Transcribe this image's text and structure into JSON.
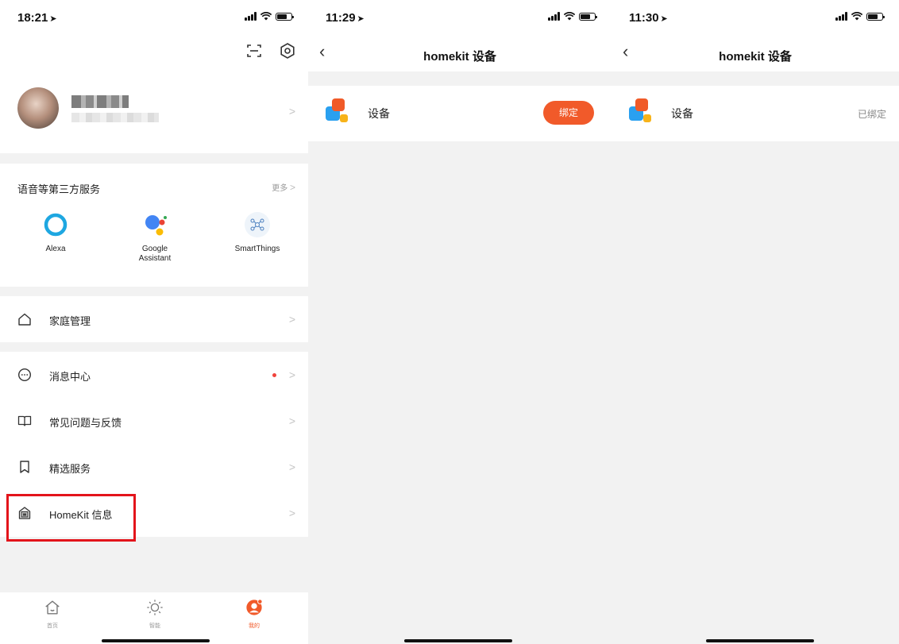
{
  "colors": {
    "accent": "#f15a2a",
    "highlight": "#e3141b",
    "notification_dot": "#f0433c",
    "background": "#f2f2f2"
  },
  "screen1": {
    "status_time": "18:21",
    "scan_icon": "scan-icon",
    "settings_icon": "settings-icon",
    "third_party": {
      "title": "语音等第三方服务",
      "more": "更多",
      "services": [
        {
          "label": "Alexa",
          "icon": "alexa-icon"
        },
        {
          "label": "Google\nAssistant",
          "icon": "google-assistant-icon"
        },
        {
          "label": "SmartThings",
          "icon": "smartthings-icon"
        }
      ]
    },
    "menu": {
      "home_mgmt": "家庭管理",
      "messages": "消息中心",
      "faq": "常见问题与反馈",
      "featured": "精选服务",
      "homekit": "HomeKit 信息"
    },
    "tabs": [
      {
        "label": "首页",
        "icon": "home-icon"
      },
      {
        "label": "智能",
        "icon": "sun-icon"
      },
      {
        "label": "我的",
        "icon": "profile-icon",
        "active": true
      }
    ]
  },
  "screen2": {
    "status_time": "11:29",
    "title": "homekit 设备",
    "device_name": "设备",
    "bind_button": "绑定"
  },
  "screen3": {
    "status_time": "11:30",
    "title": "homekit 设备",
    "device_name": "设备",
    "bound_status": "已绑定"
  }
}
